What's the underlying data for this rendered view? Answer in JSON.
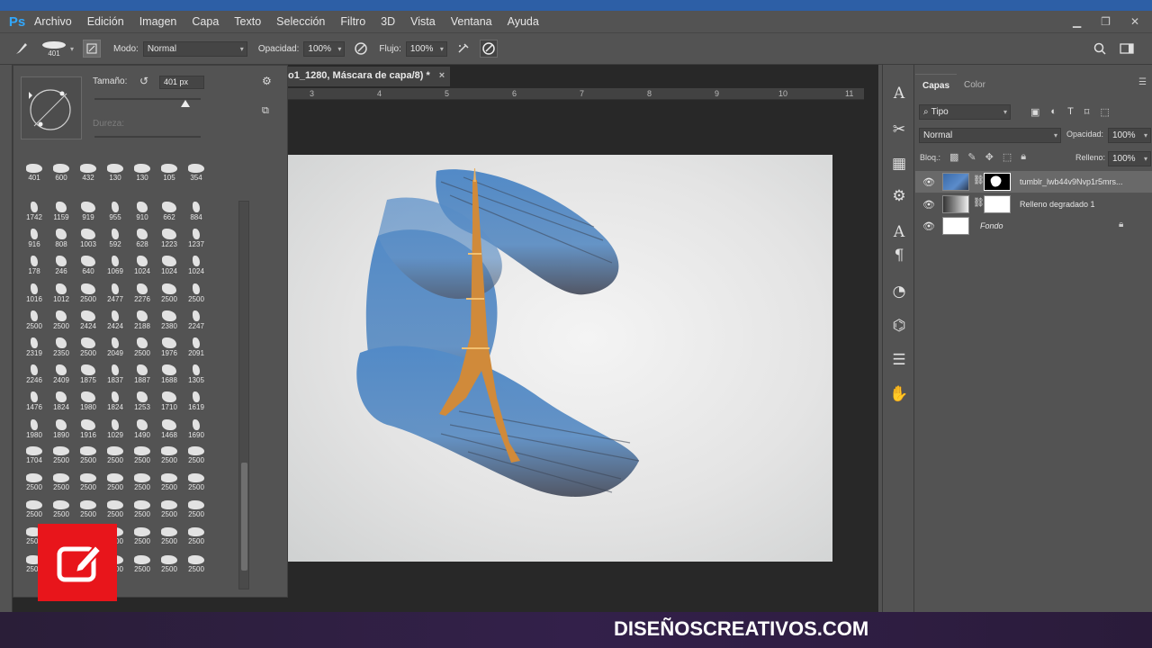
{
  "app": {
    "logo": "Ps"
  },
  "menu": [
    "Archivo",
    "Edición",
    "Imagen",
    "Capa",
    "Texto",
    "Selección",
    "Filtro",
    "3D",
    "Vista",
    "Ventana",
    "Ayuda"
  ],
  "options_bar": {
    "brush_size": "401",
    "mode_label": "Modo:",
    "mode_value": "Normal",
    "opacity_label": "Opacidad:",
    "opacity_value": "100%",
    "flow_label": "Flujo:",
    "flow_value": "100%"
  },
  "document": {
    "tab_title": "o1_1280, Máscara de capa/8) *",
    "tab_close": "×",
    "ruler_labels": [
      "3",
      "4",
      "5",
      "6",
      "7",
      "8",
      "9",
      "10",
      "11"
    ]
  },
  "brush_panel": {
    "size_label": "Tamaño:",
    "size_value": "401 px",
    "hardness_label": "Dureza:",
    "top_row": [
      "401",
      "600",
      "432",
      "130",
      "130",
      "105",
      "354"
    ],
    "grid_numbers": [
      [
        "1742",
        "1159",
        "919",
        "955",
        "910",
        "662",
        "884"
      ],
      [
        "916",
        "808",
        "1003",
        "592",
        "628",
        "1223",
        "1237"
      ],
      [
        "178",
        "246",
        "640",
        "1069",
        "1024",
        "1024",
        "1024"
      ],
      [
        "1016",
        "1012",
        "2500",
        "2477",
        "2276",
        "2500",
        "2500"
      ],
      [
        "2500",
        "2500",
        "2424",
        "2424",
        "2188",
        "2380",
        "2247"
      ],
      [
        "2319",
        "2350",
        "2500",
        "2049",
        "2500",
        "1976",
        "2091"
      ],
      [
        "2246",
        "2409",
        "1875",
        "1837",
        "1887",
        "1688",
        "1305"
      ],
      [
        "1476",
        "1824",
        "1980",
        "1824",
        "1253",
        "1710",
        "1619"
      ],
      [
        "1980",
        "1890",
        "1916",
        "1029",
        "1490",
        "1468",
        "1690"
      ],
      [
        "1704",
        "2500",
        "2500",
        "2500",
        "2500",
        "2500",
        "2500"
      ],
      [
        "2500",
        "2500",
        "2500",
        "2500",
        "2500",
        "2500",
        "2500"
      ],
      [
        "2500",
        "2500",
        "2500",
        "2500",
        "2500",
        "2500",
        "2500"
      ],
      [
        "2500",
        "2500",
        "2500",
        "2500",
        "2500",
        "2500",
        "2500"
      ],
      [
        "2500",
        "2500",
        "2500",
        "2500",
        "2500",
        "2500",
        "2500"
      ],
      [
        "2500",
        "2500",
        "2500",
        "2500",
        "2500",
        "2500",
        ""
      ]
    ]
  },
  "layers_panel": {
    "tabs": [
      "Capas",
      "Color"
    ],
    "filter_value": "Tipo",
    "blend_mode": "Normal",
    "opacity_label": "Opacidad:",
    "opacity_value": "100%",
    "lock_label": "Bloq.:",
    "fill_label": "Relleno:",
    "fill_value": "100%",
    "layers": [
      {
        "name": "tumblr_lwb44v9Nvp1r5mrs...",
        "selected": true
      },
      {
        "name": "Relleno degradado 1",
        "selected": false
      },
      {
        "name": "Fondo",
        "selected": false,
        "italic": true
      }
    ]
  },
  "footer": {
    "brand": "DISEÑOSCREATIVOS.COM"
  },
  "colors": {
    "ui_bg": "#535353",
    "doc_bg": "#282828",
    "accent": "#31a8ff",
    "brand_red": "#e8151b"
  }
}
